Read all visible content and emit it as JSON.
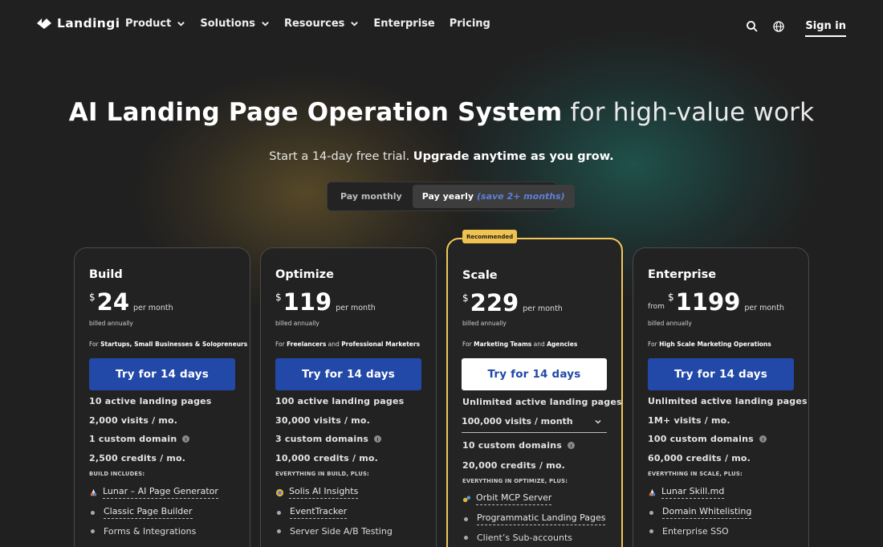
{
  "nav": {
    "logo": "Landingi",
    "items": [
      {
        "label": "Product",
        "dropdown": true
      },
      {
        "label": "Solutions",
        "dropdown": true
      },
      {
        "label": "Resources",
        "dropdown": true
      },
      {
        "label": "Enterprise",
        "dropdown": false
      },
      {
        "label": "Pricing",
        "dropdown": false
      }
    ],
    "icons": [
      "search-icon",
      "globe-icon"
    ],
    "signin": "Sign in"
  },
  "hero": {
    "title_strong": "AI Landing Page Operation System",
    "title_light": "for high-value work",
    "subtitle_plain": "Start a 14-day free trial.",
    "subtitle_bold": "Upgrade anytime as you grow."
  },
  "billing_toggle": {
    "monthly": "Pay monthly",
    "yearly": "Pay yearly",
    "yearly_note": "(save 2+ months)",
    "selected": "yearly"
  },
  "colors": {
    "accent_blue": "#2249a8",
    "recommended_gold": "#f1c75a",
    "background": "#202020"
  },
  "plans": [
    {
      "name": "Build",
      "from": "",
      "currency": "$",
      "price": "24",
      "per": "per month",
      "billed": "billed annually",
      "for_prefix": "For ",
      "for_a": "Startups, Small Businesses & Solopreneurs",
      "for_mid": "",
      "for_b": "",
      "cta": "Try for 14 days",
      "features": [
        "10 active landing pages",
        "2,000 visits / mo.",
        "1 custom domain",
        "2,500 credits / mo."
      ],
      "includes": "BUILD INCLUDES:",
      "bullets": [
        "Lunar – AI Page Generator",
        "Classic Page Builder",
        "Forms & Integrations"
      ]
    },
    {
      "name": "Optimize",
      "from": "",
      "currency": "$",
      "price": "119",
      "per": "per month",
      "billed": "billed annually",
      "for_prefix": "For ",
      "for_a": "Freelancers",
      "for_mid": " and ",
      "for_b": "Professional Marketers",
      "cta": "Try for 14 days",
      "features": [
        "100 active landing pages",
        "30,000 visits / mo.",
        "3 custom domains",
        "10,000 credits / mo."
      ],
      "includes": "EVERYTHING IN BUILD, PLUS:",
      "bullets": [
        "Solis AI Insights",
        "EventTracker",
        "Server Side A/B Testing"
      ]
    },
    {
      "name": "Scale",
      "badge": "Recommended",
      "from": "",
      "currency": "$",
      "price": "229",
      "per": "per month",
      "billed": "billed annually",
      "for_prefix": "For ",
      "for_a": "Marketing Teams",
      "for_mid": " and ",
      "for_b": "Agencies",
      "cta": "Try for 14 days",
      "features": [
        "Unlimited active landing pages",
        "100,000 visits / month",
        "10 custom domains",
        "20,000 credits / mo."
      ],
      "includes": "EVERYTHING IN OPTIMIZE, PLUS:",
      "bullets": [
        "Orbit MCP Server",
        "Programmatic Landing Pages",
        "Client’s Sub-accounts"
      ]
    },
    {
      "name": "Enterprise",
      "from": "from",
      "currency": "$",
      "price": "1199",
      "per": "per month",
      "billed": "billed annually",
      "for_prefix": "For ",
      "for_a": "High Scale Marketing Operations",
      "for_mid": "",
      "for_b": "",
      "cta": "Try for 14 days",
      "features": [
        "Unlimited active landing pages",
        "1M+ visits / mo.",
        "100 custom domains",
        "60,000 credits / mo."
      ],
      "includes": "EVERYTHING IN SCALE, PLUS:",
      "bullets": [
        "Lunar Skill.md",
        "Domain Whitelisting",
        "Enterprise SSO"
      ]
    }
  ]
}
